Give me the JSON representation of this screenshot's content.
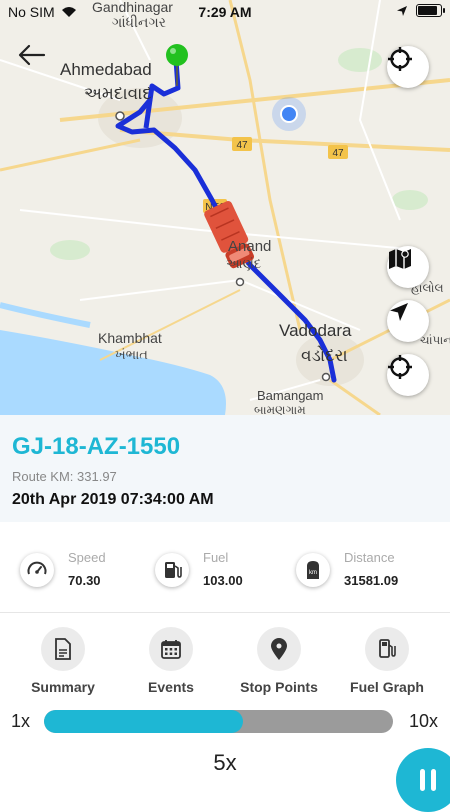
{
  "status": {
    "carrier": "No SIM",
    "time": "7:29 AM"
  },
  "map": {
    "places": {
      "gandhinagar": "Gandhinagar",
      "gandhinagar_local": "ગાંધીનગર",
      "ahmedabad": "Ahmedabad",
      "ahmedabad_local": "અમદાવાદ",
      "anand": "Anand",
      "anand_local": "આણંદ",
      "khambhat": "Khambhat",
      "khambhat_local": "ખંભાત",
      "vadodara": "Vadodara",
      "vadodara_local": "વડોદરા",
      "bamangam": "Bamangam",
      "bamangam_local": "બામણગામ",
      "halol_local": "હાલોલ",
      "champaner_local": "ચાંપાન"
    },
    "shields": {
      "nh47_a": "47",
      "nh47_b": "47",
      "ne1": "NE1"
    },
    "route_color": "#1a2fd8",
    "marker_color": "#22c11f",
    "truck_color": "#e0533c"
  },
  "vehicle": {
    "number": "GJ-18-AZ-1550",
    "route_km": "Route KM: 331.97",
    "datetime": "20th Apr 2019 07:34:00 AM"
  },
  "stats": {
    "speed": {
      "label": "Speed",
      "value": "70.30",
      "icon": "speedometer-icon"
    },
    "fuel": {
      "label": "Fuel",
      "value": "103.00",
      "icon": "fuel-pump-icon"
    },
    "distance": {
      "label": "Distance",
      "value": "31581.09",
      "icon": "odometer-km-icon"
    }
  },
  "actions": [
    {
      "label": "Summary",
      "icon": "document-icon"
    },
    {
      "label": "Events",
      "icon": "calendar-icon"
    },
    {
      "label": "Stop Points",
      "icon": "map-pin-icon"
    },
    {
      "label": "Fuel Graph",
      "icon": "fuel-icon"
    }
  ],
  "playback": {
    "min_label": "1x",
    "max_label": "10x",
    "current_label": "5x",
    "progress_fraction": 0.57
  },
  "colors": {
    "accent": "#1eb7d4",
    "panel_bg": "#f3f7fa"
  }
}
